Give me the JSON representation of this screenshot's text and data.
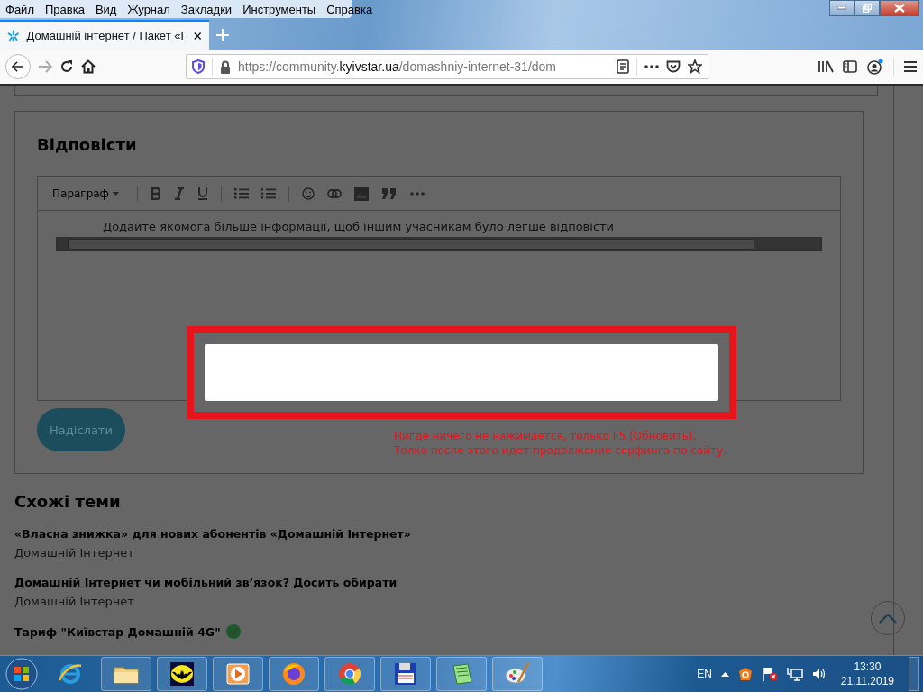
{
  "menu_bar": [
    "Файл",
    "Правка",
    "Вид",
    "Журнал",
    "Закладки",
    "Инструменты",
    "Справка"
  ],
  "tabs": [
    {
      "title": "Домашній інтернет / Пакет «Г",
      "selected": true
    }
  ],
  "address_bar": {
    "prefix": "https://community.",
    "domain": "kyivstar.ua",
    "path": "/domashniy-internet-31/dom"
  },
  "reply": {
    "title": "Відповісти",
    "format": "Параграф",
    "placeholder": "Додайте якомога більше інформації, щоб іншим учасникам було легше відповісти",
    "send_button": "Надіслати"
  },
  "annotation": {
    "lines": [
      "Нигде ничего не нажимается, только F5 (Обновить).",
      "Толко после этого идет продолжение серфинга по сайту."
    ]
  },
  "related": {
    "title": "Схожі теми",
    "topics": [
      {
        "title": "«Власна знижка» для нових абонентів «Домашній Інтернет»",
        "category": "Домашній Інтернет",
        "verified": false
      },
      {
        "title": "Домашній Інтернет чи мобільний зв’язок? Досить обирати",
        "category": "Домашній Інтернет",
        "verified": false
      },
      {
        "title": "Тариф \"Київстар Домашній 4G\"",
        "verified": true
      }
    ]
  },
  "taskbar": {
    "language": "EN",
    "time": "13:30",
    "date": "21.11.2019"
  }
}
